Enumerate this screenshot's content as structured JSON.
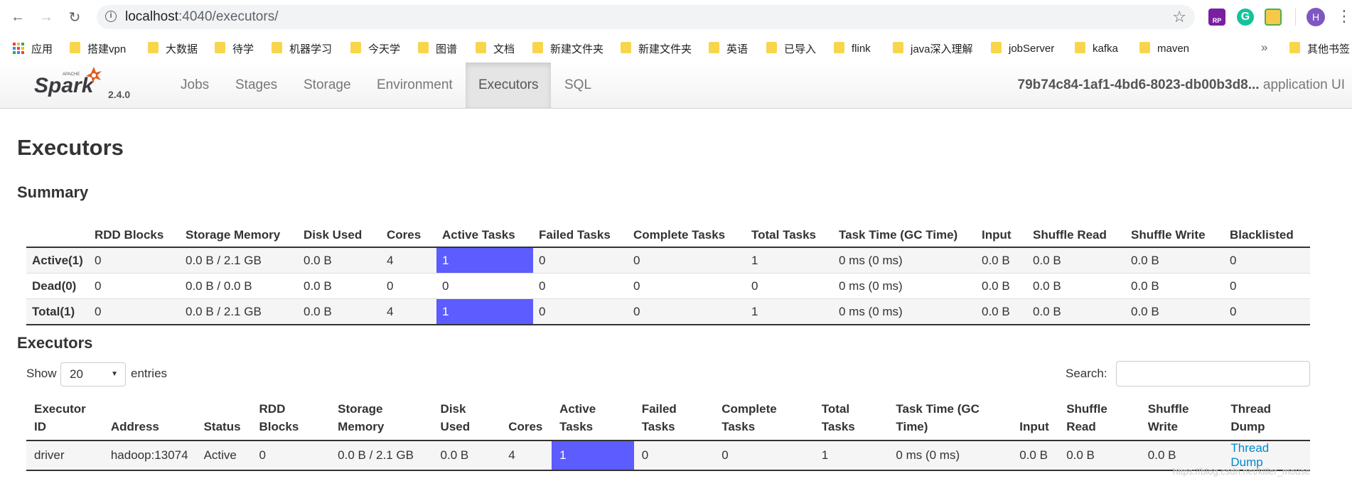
{
  "browser": {
    "url_host": "localhost",
    "url_path": ":4040/executors/",
    "avatar_letter": "H",
    "ext_rp_label": "RP",
    "ext_g_label": "G",
    "bookmarks": [
      {
        "label": "应用",
        "type": "apps"
      },
      {
        "label": "搭建vpn"
      },
      {
        "label": "大数据"
      },
      {
        "label": "待学"
      },
      {
        "label": "机器学习"
      },
      {
        "label": "今天学"
      },
      {
        "label": "图谱"
      },
      {
        "label": "文档"
      },
      {
        "label": "新建文件夹"
      },
      {
        "label": "新建文件夹"
      },
      {
        "label": "英语"
      },
      {
        "label": "已导入"
      },
      {
        "label": "flink"
      },
      {
        "label": "java深入理解"
      },
      {
        "label": "jobServer"
      },
      {
        "label": "kafka"
      },
      {
        "label": "maven"
      }
    ],
    "more_label": "»",
    "other_bookmarks": "其他书签"
  },
  "spark": {
    "version": "2.4.0",
    "tabs": [
      "Jobs",
      "Stages",
      "Storage",
      "Environment",
      "Executors",
      "SQL"
    ],
    "active_tab": "Executors",
    "app_id": "79b74c84-1af1-4bd6-8023-db00b3d8...",
    "app_suffix": " application UI"
  },
  "page": {
    "title": "Executors",
    "summary_heading": "Summary",
    "executors_heading": "Executors"
  },
  "summary": {
    "headers": [
      "",
      "RDD Blocks",
      "Storage Memory",
      "Disk Used",
      "Cores",
      "Active Tasks",
      "Failed Tasks",
      "Complete Tasks",
      "Total Tasks",
      "Task Time (GC Time)",
      "Input",
      "Shuffle Read",
      "Shuffle Write",
      "Blacklisted"
    ],
    "rows": [
      [
        "Active(1)",
        "0",
        "0.0 B / 2.1 GB",
        "0.0 B",
        "4",
        "1",
        "0",
        "0",
        "1",
        "0 ms (0 ms)",
        "0.0 B",
        "0.0 B",
        "0.0 B",
        "0"
      ],
      [
        "Dead(0)",
        "0",
        "0.0 B / 0.0 B",
        "0.0 B",
        "0",
        "0",
        "0",
        "0",
        "0",
        "0 ms (0 ms)",
        "0.0 B",
        "0.0 B",
        "0.0 B",
        "0"
      ],
      [
        "Total(1)",
        "0",
        "0.0 B / 2.1 GB",
        "0.0 B",
        "4",
        "1",
        "0",
        "0",
        "1",
        "0 ms (0 ms)",
        "0.0 B",
        "0.0 B",
        "0.0 B",
        "0"
      ]
    ]
  },
  "controls": {
    "show_label": "Show",
    "entries_value": "20",
    "entries_label": "entries",
    "search_label": "Search:"
  },
  "executors": {
    "headers": [
      "Executor ID",
      "Address",
      "Status",
      "RDD Blocks",
      "Storage Memory",
      "Disk Used",
      "Cores",
      "Active Tasks",
      "Failed Tasks",
      "Complete Tasks",
      "Total Tasks",
      "Task Time (GC Time)",
      "Input",
      "Shuffle Read",
      "Shuffle Write",
      "Thread Dump"
    ],
    "rows": [
      [
        "driver",
        "hadoop:13074",
        "Active",
        "0",
        "0.0 B / 2.1 GB",
        "0.0 B",
        "4",
        "1",
        "0",
        "0",
        "1",
        "0 ms (0 ms)",
        "0.0 B",
        "0.0 B",
        "0.0 B",
        "Thread Dump"
      ]
    ]
  },
  "colors": {
    "active_task_bar": "#5c5cff",
    "link": "#0088cc"
  },
  "watermark": "https://blog.csdn.net/killer_mouse"
}
